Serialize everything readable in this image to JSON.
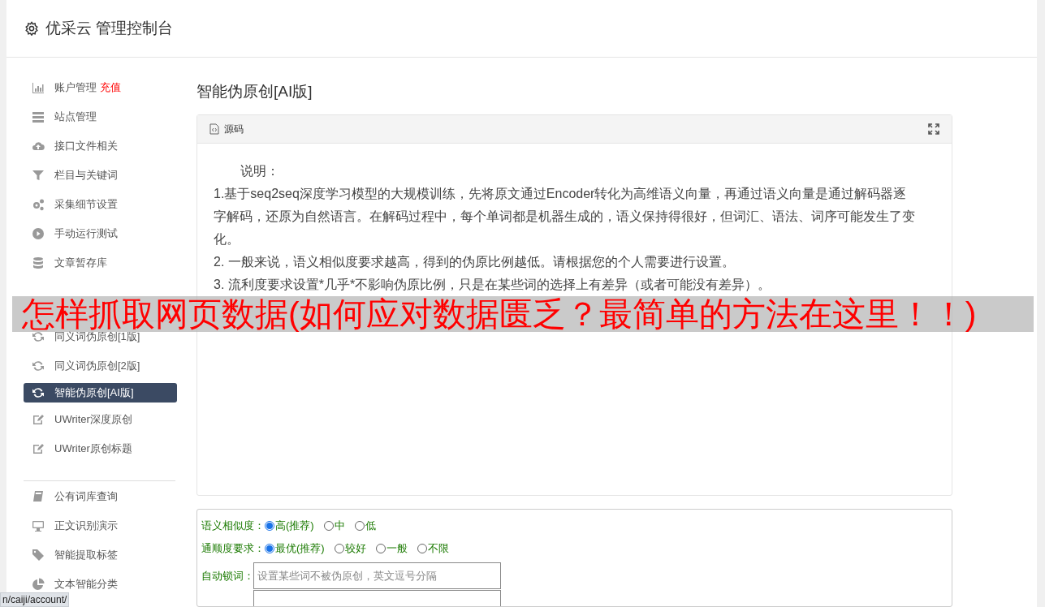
{
  "header": {
    "title": "优采云 管理控制台"
  },
  "sidebar": {
    "groups": [
      [
        {
          "label": "账户管理",
          "badge": "充值",
          "selected": false
        },
        {
          "label": "站点管理",
          "selected": false
        },
        {
          "label": "接口文件相关",
          "selected": false
        },
        {
          "label": "栏目与关键词",
          "selected": false
        },
        {
          "label": "采集细节设置",
          "selected": false
        },
        {
          "label": "手动运行测试",
          "selected": false
        },
        {
          "label": "文章暂存库",
          "selected": false
        }
      ],
      [
        {
          "label": "同义词伪原创[1版]",
          "selected": false
        },
        {
          "label": "同义词伪原创[2版]",
          "selected": false
        },
        {
          "label": "智能伪原创[AI版]",
          "selected": true
        },
        {
          "label": "UWriter深度原创",
          "selected": false
        },
        {
          "label": "UWriter原创标题",
          "selected": false
        }
      ],
      [
        {
          "label": "公有词库查询",
          "selected": false
        },
        {
          "label": "正文识别演示",
          "selected": false
        },
        {
          "label": "智能提取标签",
          "selected": false
        },
        {
          "label": "文本智能分类",
          "selected": false
        }
      ]
    ]
  },
  "content": {
    "title": "智能伪原创[AI版]",
    "panel": {
      "tab": "源码",
      "lines": [
        "说明：",
        "1.基于seq2seq深度学习模型的大规模训练，先将原文通过Encoder转化为高维语义向量，再通过语义向量是通过解码器逐字解码，还原为自然语言。在解码过程中，每个单词都是机器生成的，语义保持得很好，但词汇、语法、词序可能发生了变化。",
        "2. 一般来说，语义相似度要求越高，得到的伪原比例越低。请根据您的个人需要进行设置。",
        "3. 流利度要求设置*几乎*不影响伪原比例，只是在某些词的选择上有差异（或者可能没有差异）。"
      ]
    },
    "form": {
      "radio_groups": [
        {
          "label": "语义相似度：",
          "options": [
            {
              "label": "高(推荐)",
              "selected": true
            },
            {
              "label": "中",
              "selected": false
            },
            {
              "label": "低",
              "selected": false
            }
          ]
        },
        {
          "label": "通顺度要求：",
          "options": [
            {
              "label": "最优(推荐)",
              "selected": true
            },
            {
              "label": "较好",
              "selected": false
            },
            {
              "label": "一般",
              "selected": false
            },
            {
              "label": "不限",
              "selected": false
            }
          ]
        }
      ],
      "lock_words": {
        "label": "自动锁词：",
        "placeholder": "设置某些词不被伪原创，英文逗号分隔"
      }
    }
  },
  "banner": "怎样抓取网页数据(如何应对数据匮乏？最简单的方法在这里！！)",
  "status_bar": "n/caiji/account/"
}
